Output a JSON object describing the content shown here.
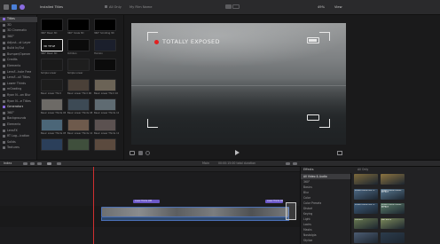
{
  "toolbar": {
    "browser_title": "Installed Titles",
    "library_filter": "All Only",
    "project_name": "My Film Name",
    "zoom": "49%",
    "view_label": "View"
  },
  "sidebar": {
    "items": [
      {
        "label": "Titles",
        "type": "lib"
      },
      {
        "label": "3D",
        "type": "cat"
      },
      {
        "label": "3D Cinematic",
        "type": "cat"
      },
      {
        "label": "360°",
        "type": "cat"
      },
      {
        "label": "Adjust...st Layer",
        "type": "cat"
      },
      {
        "label": "Build In/Out",
        "type": "cat"
      },
      {
        "label": "Bumper/Opener",
        "type": "cat"
      },
      {
        "label": "Credits",
        "type": "cat"
      },
      {
        "label": "Elements",
        "type": "cat"
      },
      {
        "label": "LensF...hole Free",
        "type": "cat"
      },
      {
        "label": "LensF...ull Titles",
        "type": "cat"
      },
      {
        "label": "Lower Thirds",
        "type": "cat"
      },
      {
        "label": "mGrading",
        "type": "cat"
      },
      {
        "label": "Ryan N...on Blur",
        "type": "cat"
      },
      {
        "label": "Ryan N...e Titles",
        "type": "cat"
      },
      {
        "label": "Generators",
        "type": "lib"
      },
      {
        "label": "360°",
        "type": "cat"
      },
      {
        "label": "Backgrounds",
        "type": "cat"
      },
      {
        "label": "Elements",
        "type": "cat"
      },
      {
        "label": "LensFX",
        "type": "cat"
      },
      {
        "label": "RT Log...ication",
        "type": "cat"
      },
      {
        "label": "Solids",
        "type": "cat"
      },
      {
        "label": "Textures",
        "type": "cat"
      }
    ]
  },
  "browser": {
    "thumbs": [
      {
        "label": "360° Basic 3D",
        "bg": "#000000",
        "text": ""
      },
      {
        "label": "360° Scale 3D",
        "bg": "#000000",
        "text": ""
      },
      {
        "label": "360° Scrolling 3D",
        "bg": "#000000",
        "text": ""
      },
      {
        "label": "360° Basic 3D",
        "bg": "#0e0e0e",
        "text": "3D TITLE"
      },
      {
        "label": "Ochilian",
        "bg": "#0b0b0b",
        "text": ""
      },
      {
        "label": "Horizon",
        "bg": "#1b1f2c",
        "text": ""
      },
      {
        "label": "Simple Lower",
        "bg": "#1a1a1a",
        "text": ""
      },
      {
        "label": "Simple Lower",
        "bg": "#1e1e1e",
        "text": ""
      },
      {
        "label": "",
        "bg": "#0b0b0b",
        "text": ""
      },
      {
        "label": "Basic Lower Third",
        "bg": "#1d1d1d",
        "text": ""
      },
      {
        "label": "Basic Lower Third 06",
        "bg": "#4a4038",
        "text": ""
      },
      {
        "label": "Basic Lower Third 10",
        "bg": "#6b6356",
        "text": ""
      },
      {
        "label": "Basic Lower Thirds 06",
        "bg": "#6d6a66",
        "text": ""
      },
      {
        "label": "Basic Lower Thirds 08",
        "bg": "#3d4a55",
        "text": ""
      },
      {
        "label": "Basic Lower Thirds 10",
        "bg": "#5f6b72",
        "text": ""
      },
      {
        "label": "Basic Lower Thirds 05",
        "bg": "#4b6678",
        "text": ""
      },
      {
        "label": "Basic Lower Thirds 10",
        "bg": "#6e5a4c",
        "text": ""
      },
      {
        "label": "Basic Lower Thirds 11",
        "bg": "#5b5150",
        "text": ""
      },
      {
        "label": "",
        "bg": "#2b3f5a",
        "text": ""
      },
      {
        "label": "",
        "bg": "#3f4f3c",
        "text": ""
      },
      {
        "label": "",
        "bg": "#5b4a3e",
        "text": ""
      }
    ]
  },
  "viewer": {
    "rec_text": "TOTALLY EXPOSED"
  },
  "timeline": {
    "tab_label": "Index",
    "center_text": "Main",
    "duration": "00:00:15:00 total duration",
    "title_clip_1": "Lower Thirds 10B",
    "title_clip_2": "Lower Thirds 10B"
  },
  "effects": {
    "header": "Effects",
    "right_header": "All Only",
    "list": [
      {
        "label": "All Video & Audio",
        "selected": true
      },
      {
        "label": "360°",
        "selected": false
      },
      {
        "label": "Basics",
        "selected": false
      },
      {
        "label": "Blur",
        "selected": false
      },
      {
        "label": "Color",
        "selected": false
      },
      {
        "label": "Color Presets",
        "selected": false
      },
      {
        "label": "Distort",
        "selected": false
      },
      {
        "label": "Keying",
        "selected": false
      },
      {
        "label": "Light",
        "selected": false
      },
      {
        "label": "Looks",
        "selected": false
      },
      {
        "label": "Masks",
        "selected": false
      },
      {
        "label": "Nostalgia",
        "selected": false
      },
      {
        "label": "Stylize",
        "selected": false
      }
    ],
    "thumbs": [
      {
        "label": "",
        "bg": "#7d6a3c"
      },
      {
        "label": "",
        "bg": "#8c7440"
      },
      {
        "label": "LUMAFUSION 360 Fx",
        "bg": "#4d6a86"
      },
      {
        "label": "LUMAFUSION FRAME EFFECT",
        "bg": "#5a7a92"
      },
      {
        "label": "LUMAFUSION 360 Fx",
        "bg": "#3d5c7a"
      },
      {
        "label": "LUMAFUSION FRAME EFFECT",
        "bg": "#5c7e6a"
      },
      {
        "label": "Camera",
        "bg": "#6a7a50"
      },
      {
        "label": "Ken Burns",
        "bg": "#7c8a5a"
      },
      {
        "label": "",
        "bg": "#4c5c72"
      },
      {
        "label": "",
        "bg": "#2c3c4c"
      }
    ]
  },
  "colors": {
    "accent": "#7b5fe0",
    "rec": "#e22020",
    "clip": "#4a6fb5",
    "title_clip": "#6c58c8",
    "playhead": "#d03030"
  }
}
